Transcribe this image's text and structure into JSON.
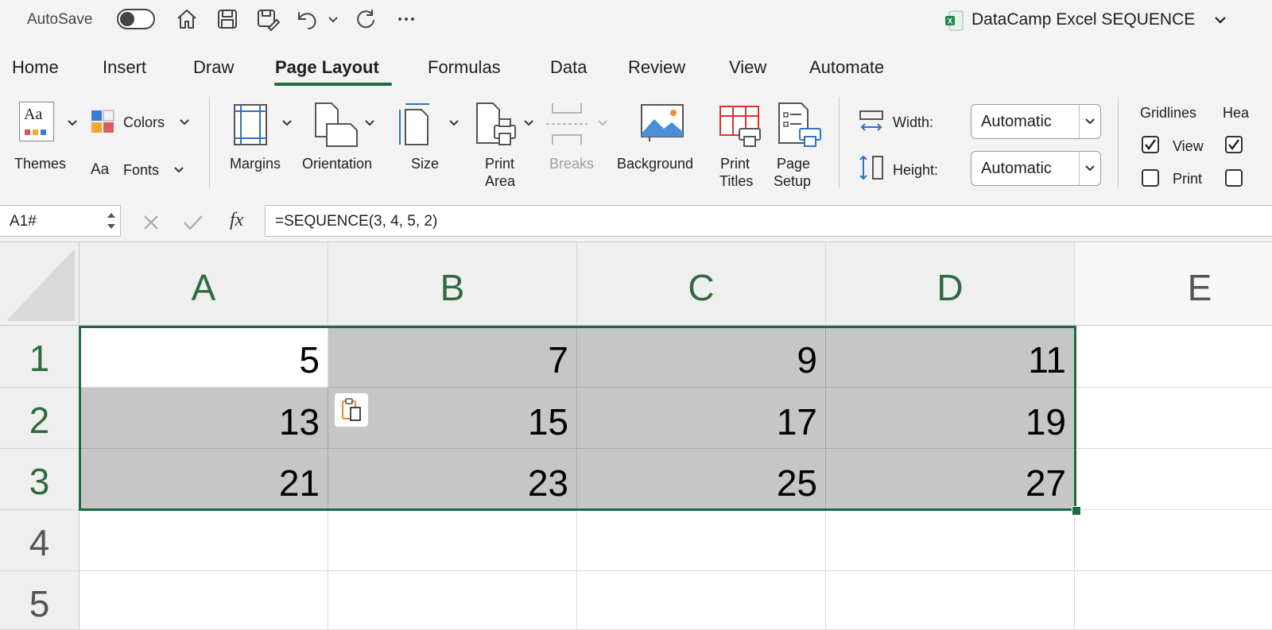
{
  "titlebar": {
    "autosave_label": "AutoSave",
    "document_title": "DataCamp Excel SEQUENCE",
    "icons": [
      "home-icon",
      "save-icon",
      "save-edit-icon",
      "undo-icon",
      "redo-icon",
      "more-icon"
    ]
  },
  "tabs": [
    {
      "label": "Home",
      "active": false
    },
    {
      "label": "Insert",
      "active": false
    },
    {
      "label": "Draw",
      "active": false
    },
    {
      "label": "Page Layout",
      "active": true
    },
    {
      "label": "Formulas",
      "active": false
    },
    {
      "label": "Data",
      "active": false
    },
    {
      "label": "Review",
      "active": false
    },
    {
      "label": "View",
      "active": false
    },
    {
      "label": "Automate",
      "active": false
    }
  ],
  "ribbon": {
    "themes": "Themes",
    "colors": "Colors",
    "fonts": "Fonts",
    "fonts_glyph": "Aa",
    "themes_glyph": "Aa",
    "margins": "Margins",
    "orientation": "Orientation",
    "size": "Size",
    "print_area_line1": "Print",
    "print_area_line2": "Area",
    "breaks": "Breaks",
    "background": "Background",
    "print_titles_line1": "Print",
    "print_titles_line2": "Titles",
    "page_setup_line1": "Page",
    "page_setup_line2": "Setup",
    "width_label": "Width:",
    "width_value": "Automatic",
    "height_label": "Height:",
    "height_value": "Automatic",
    "gridlines": "Gridlines",
    "gridlines_view": "View",
    "gridlines_print": "Print",
    "headings_partial": "Hea"
  },
  "formula_bar": {
    "name_box": "A1#",
    "fx": "fx",
    "formula": "=SEQUENCE(3, 4, 5, 2)"
  },
  "sheet": {
    "columns": [
      "A",
      "B",
      "C",
      "D",
      "E"
    ],
    "rows": [
      "1",
      "2",
      "3",
      "4",
      "5"
    ],
    "cells": [
      [
        "5",
        "7",
        "9",
        "11"
      ],
      [
        "13",
        "15",
        "17",
        "19"
      ],
      [
        "21",
        "23",
        "25",
        "27"
      ]
    ]
  },
  "colors": {
    "accent": "#1d6b3e",
    "spill_fill": "#c6c6c6",
    "header_text": "#2f6b3e"
  }
}
